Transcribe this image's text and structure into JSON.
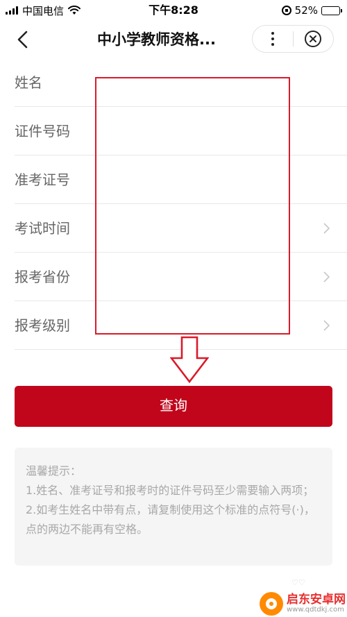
{
  "status": {
    "carrier": "中国电信",
    "time": "下午8:28",
    "battery": "52%",
    "battery_level": 0.52
  },
  "nav": {
    "title": "中小学教师资格...",
    "icons": [
      "back-chevron-icon",
      "more-dots-icon",
      "close-circle-icon"
    ]
  },
  "form": {
    "rows": [
      {
        "label": "姓名",
        "has_chevron": false
      },
      {
        "label": "证件号码",
        "has_chevron": false
      },
      {
        "label": "准考证号",
        "has_chevron": false
      },
      {
        "label": "考试时间",
        "has_chevron": true
      },
      {
        "label": "报考省份",
        "has_chevron": true
      },
      {
        "label": "报考级别",
        "has_chevron": true
      }
    ]
  },
  "query_button": "查询",
  "tips": {
    "title": "温馨提示：",
    "line1": "1.姓名、准考证号和报考时的证件号码至少需要输入两项；",
    "line2": "2.如考生姓名中带有点，请复制使用这个标准的点符号(·)，点的两边不能再有空格。"
  },
  "watermark": {
    "name": "启东安卓网",
    "url": "www.qdtdkj.com"
  },
  "colors": {
    "accent": "#c1061b",
    "annotation": "#d91a2a"
  }
}
